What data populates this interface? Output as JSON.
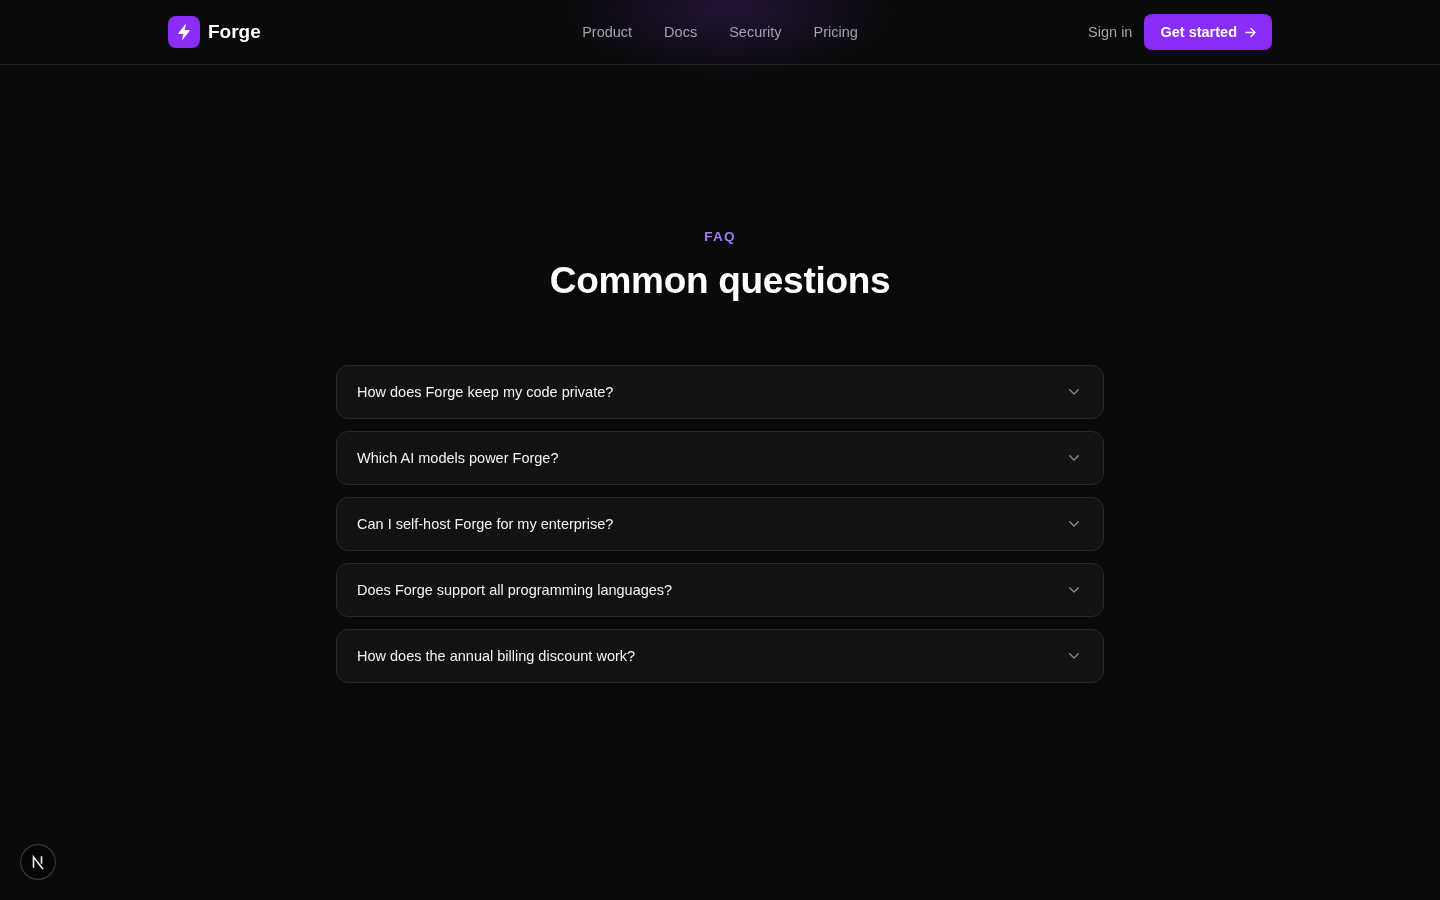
{
  "header": {
    "brand": "Forge",
    "nav": [
      "Product",
      "Docs",
      "Security",
      "Pricing"
    ],
    "sign_in": "Sign in",
    "cta": "Get started"
  },
  "faq": {
    "eyebrow": "FAQ",
    "title": "Common questions",
    "items": [
      {
        "question": "How does Forge keep my code private?",
        "expanded": false
      },
      {
        "question": "Which AI models power Forge?",
        "expanded": false
      },
      {
        "question": "Can I self-host Forge for my enterprise?",
        "expanded": false
      },
      {
        "question": "Does Forge support all programming languages?",
        "expanded": false
      },
      {
        "question": "How does the annual billing discount work?",
        "expanded": false
      }
    ]
  }
}
